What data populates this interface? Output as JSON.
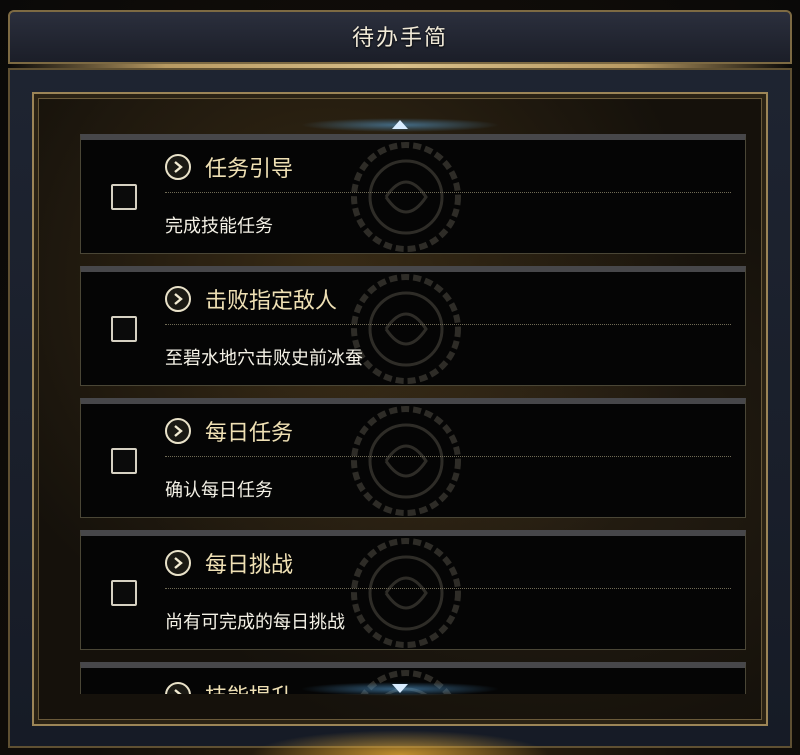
{
  "window": {
    "title": "待办手简"
  },
  "todos": [
    {
      "title": "任务引导",
      "description": "完成技能任务",
      "checked": false
    },
    {
      "title": "击败指定敌人",
      "description": "至碧水地穴击败史前冰蚕",
      "checked": false
    },
    {
      "title": "每日任务",
      "description": "确认每日任务",
      "checked": false
    },
    {
      "title": "每日挑战",
      "description": "尚有可完成的每日挑战",
      "checked": false
    },
    {
      "title": "技能提升",
      "description": "",
      "checked": false
    }
  ],
  "icons": {
    "expand": "chevron-right-icon",
    "scroll_up": "triangle-up-icon",
    "scroll_down": "triangle-down-icon"
  },
  "colors": {
    "title_text": "#f1ead8",
    "item_title": "#efe0b4",
    "item_desc": "#f4f1e6",
    "frame_gold": "#9c8557",
    "card_bg": "#050505",
    "scroll_glow": "#5aaae6"
  }
}
